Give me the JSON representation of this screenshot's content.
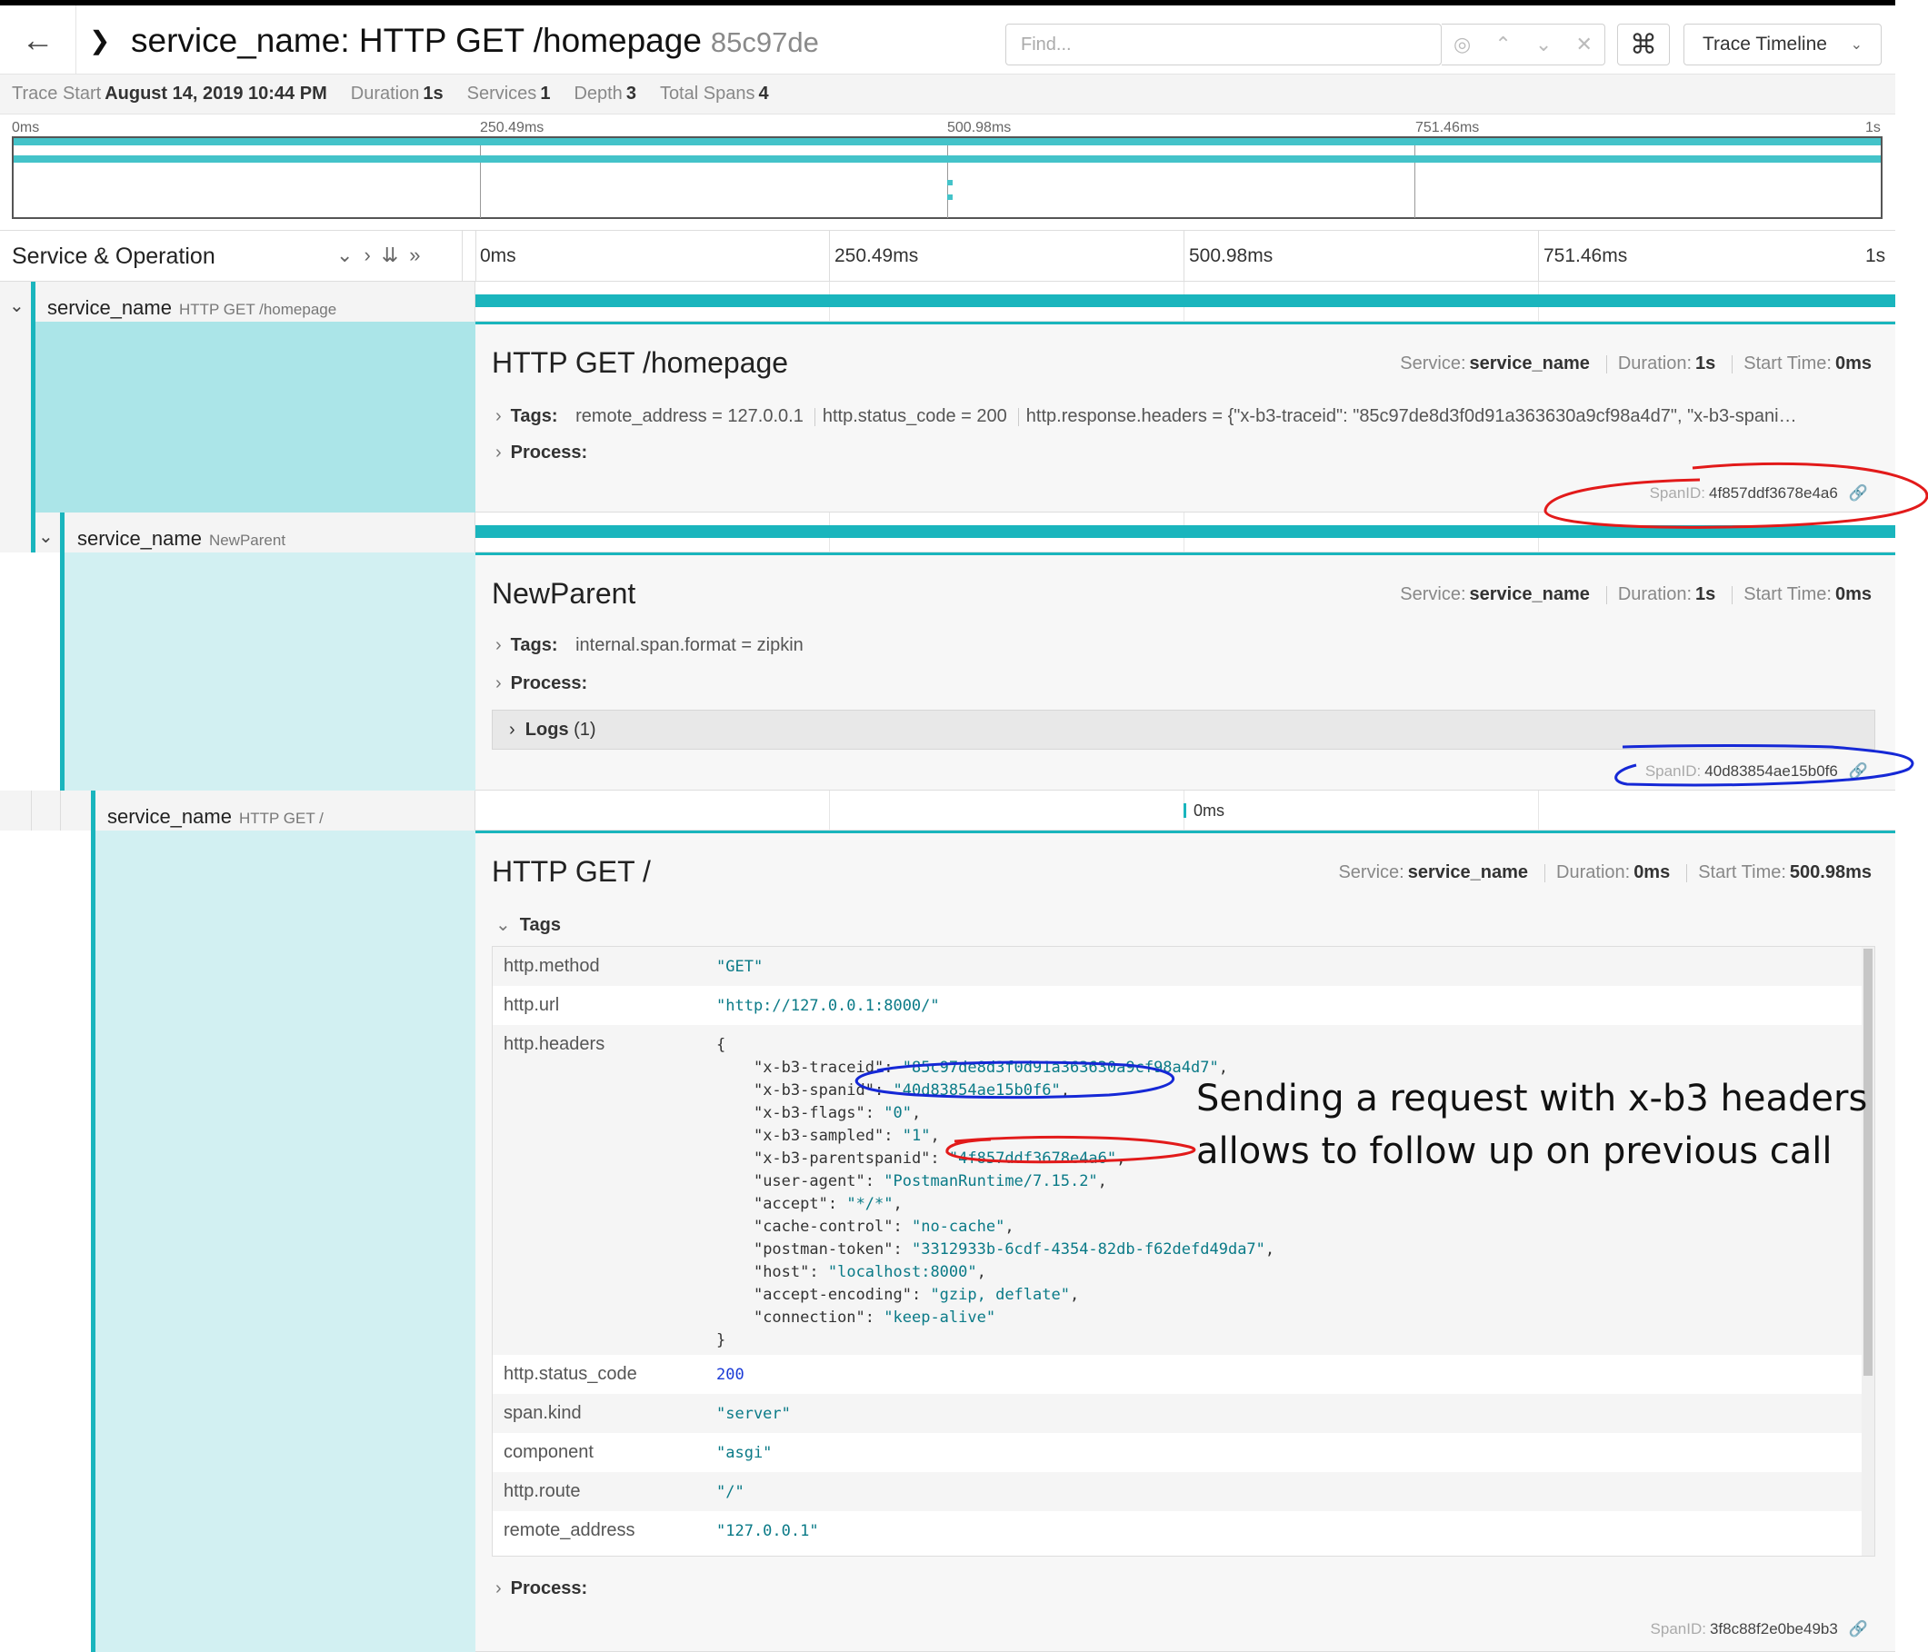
{
  "header": {
    "title": "service_name: HTTP GET /homepage",
    "trace_id": "85c97de",
    "find_placeholder": "Find...",
    "view_label": "Trace Timeline"
  },
  "stats": {
    "trace_start_label": "Trace Start",
    "trace_start": "August 14, 2019 10:44 PM",
    "duration_label": "Duration",
    "duration": "1s",
    "services_label": "Services",
    "services": "1",
    "depth_label": "Depth",
    "depth": "3",
    "total_spans_label": "Total Spans",
    "total_spans": "4"
  },
  "ticks": [
    "0ms",
    "250.49ms",
    "500.98ms",
    "751.46ms",
    "1s"
  ],
  "columns": {
    "service_operation": "Service & Operation"
  },
  "spans": [
    {
      "service": "service_name",
      "operation": "HTTP GET /homepage",
      "title": "HTTP GET /homepage",
      "service_label": "Service:",
      "duration_label": "Duration:",
      "start_label": "Start Time:",
      "duration": "1s",
      "start_time": "0ms",
      "tags_label": "Tags:",
      "tags_inline": [
        {
          "key": "remote_address",
          "value": "127.0.0.1"
        },
        {
          "key": "http.status_code",
          "value": "200"
        },
        {
          "key": "http.response.headers",
          "value": "{\"x-b3-traceid\": \"85c97de8d3f0d91a363630a9cf98a4d7\", \"x-b3-spani…"
        }
      ],
      "process_label": "Process:",
      "span_id_label": "SpanID:",
      "span_id": "4f857ddf3678e4a6",
      "bar_fraction": 1.0
    },
    {
      "service": "service_name",
      "operation": "NewParent",
      "title": "NewParent",
      "service_label": "Service:",
      "duration_label": "Duration:",
      "start_label": "Start Time:",
      "duration": "1s",
      "start_time": "0ms",
      "tags_label": "Tags:",
      "tags_inline": [
        {
          "key": "internal.span.format",
          "value": "zipkin"
        }
      ],
      "process_label": "Process:",
      "logs_label": "Logs",
      "logs_count": "(1)",
      "span_id_label": "SpanID:",
      "span_id": "40d83854ae15b0f6",
      "bar_fraction": 1.0
    },
    {
      "service": "service_name",
      "operation": "HTTP GET /",
      "title": "HTTP GET /",
      "service_label": "Service:",
      "duration_label": "Duration:",
      "start_label": "Start Time:",
      "duration": "0ms",
      "start_time": "500.98ms",
      "bar_label": "0ms",
      "tags_label": "Tags",
      "tags": [
        {
          "key": "http.method",
          "value": "\"GET\""
        },
        {
          "key": "http.url",
          "value": "\"http://127.0.0.1:8000/\""
        },
        {
          "key": "http.headers",
          "value": ""
        },
        {
          "key": "http.status_code",
          "value": "200"
        },
        {
          "key": "span.kind",
          "value": "\"server\""
        },
        {
          "key": "component",
          "value": "\"asgi\""
        },
        {
          "key": "http.route",
          "value": "\"/\""
        },
        {
          "key": "remote_address",
          "value": "\"127.0.0.1\""
        }
      ],
      "headers_json": [
        {
          "k": "\"x-b3-traceid\"",
          "v": "\"85c97de8d3f0d91a363630a9cf98a4d7\""
        },
        {
          "k": "\"x-b3-spanid\"",
          "v": "\"40d83854ae15b0f6\""
        },
        {
          "k": "\"x-b3-flags\"",
          "v": "\"0\""
        },
        {
          "k": "\"x-b3-sampled\"",
          "v": "\"1\""
        },
        {
          "k": "\"x-b3-parentspanid\"",
          "v": "\"4f857ddf3678e4a6\""
        },
        {
          "k": "\"user-agent\"",
          "v": "\"PostmanRuntime/7.15.2\""
        },
        {
          "k": "\"accept\"",
          "v": "\"*/*\""
        },
        {
          "k": "\"cache-control\"",
          "v": "\"no-cache\""
        },
        {
          "k": "\"postman-token\"",
          "v": "\"3312933b-6cdf-4354-82db-f62defd49da7\""
        },
        {
          "k": "\"host\"",
          "v": "\"localhost:8000\""
        },
        {
          "k": "\"accept-encoding\"",
          "v": "\"gzip, deflate\""
        },
        {
          "k": "\"connection\"",
          "v": "\"keep-alive\""
        }
      ],
      "process_label": "Process:",
      "span_id_label": "SpanID:",
      "span_id": "3f8c88f2e0be49b3"
    }
  ],
  "annotation": {
    "line1": "Sending a request with x-b3 headers",
    "line2": "allows to follow up on previous call"
  },
  "colors": {
    "span_bar": "#1ab5bd",
    "left_fill_1": "#abe5e8",
    "left_fill_2": "#d2f0f2",
    "ink_red": "#e21a1a",
    "ink_blue": "#1528d6"
  }
}
